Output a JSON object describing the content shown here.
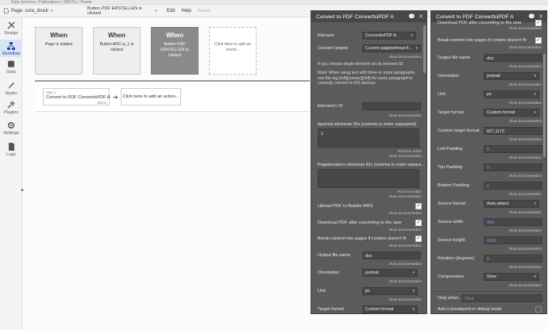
{
  "top_strip": {
    "text": "Data Schema  |  Publications | SMOSs  |  Viewer"
  },
  "toolbar": {
    "page_label": "Page: sora_druck",
    "event_selector": "Button PDF ERSTELLEN is clicked",
    "edit": "Edit",
    "help": "Help",
    "saved": "Saved"
  },
  "sidebar": {
    "items": [
      {
        "label": "Design",
        "icon": "design-icon"
      },
      {
        "label": "Workflow",
        "icon": "workflow-icon"
      },
      {
        "label": "Data",
        "icon": "data-icon"
      },
      {
        "label": "Styles",
        "icon": "styles-icon"
      },
      {
        "label": "Plugins",
        "icon": "plugins-icon"
      },
      {
        "label": "Settings",
        "icon": "settings-icon"
      },
      {
        "label": "Logs",
        "icon": "logs-icon"
      }
    ]
  },
  "events": [
    {
      "when": "When",
      "desc": "Page is loaded"
    },
    {
      "when": "When",
      "desc": "Button ARC-a_1 is clicked"
    },
    {
      "when": "When",
      "desc": "Button PDF ERSTELLEN is clicked"
    },
    {
      "when": "",
      "desc": "Click here to add an event..."
    }
  ],
  "actions": {
    "step_label": "Step 1",
    "step_name": "Convert to PDF ConverttoPDF A",
    "step_delete": "delete",
    "add_action": "Click here to add an action..."
  },
  "panel_left": {
    "title": "Convert to PDF ConverttoPDF A",
    "element_label": "Element",
    "element_value": "ConverttoPDF A",
    "convert_targets_label": "Convert targets",
    "convert_targets_value": "Current page(without fi...",
    "show_doc": "show documentation",
    "note_single": "If you choose single element set its element ID",
    "note_three": "Note! When using text with three or more paragraphs, use the tag [left][/center][/left] for every paragraph to correctly convert in iOS devices",
    "element_id_label": "Element's ID",
    "ignored_label": "Ignored elements IDs (comma or enter separated)",
    "ignored_value": "1",
    "rich_text": "Rich text editor",
    "pagebreakers_label": "Pagebreakers elements IDs (comma or enter separa...",
    "upload_label": "Upload PDF to Bubble AWS",
    "download_label": "Download PDF after converting to the user",
    "break_label": "Break content into pages if content doesn't fit",
    "output_name_label": "Output file name",
    "output_name_value": "doc",
    "orientation_label": "Orientation",
    "orientation_value": "portrait",
    "unit_label": "Unit",
    "unit_value": "px",
    "target_format_label": "Target format",
    "target_format_value": "Custom format"
  },
  "panel_right": {
    "title": "Convert to PDF ConverttoPDF A",
    "download_label": "Download PDF after converting to the user",
    "break_label": "Break content into pages if content doesn't fit",
    "output_name_label": "Output file name",
    "output_name_value": "doc",
    "orientation_label": "Orientation",
    "orientation_value": "portrait",
    "unit_label": "Unit",
    "unit_value": "px",
    "target_format_label": "Target format",
    "target_format_value": "Custom format",
    "custom_target_label": "Custom target format",
    "custom_target_value": "827,1170",
    "left_padding_label": "Left Padding",
    "left_padding_value": "0",
    "top_padding_label": "Top Padding",
    "top_padding_value": "0",
    "bottom_padding_label": "Bottom Padding",
    "bottom_padding_value": "0",
    "source_format_label": "Source format",
    "source_format_value": "Auto-detect",
    "source_width_label": "Source width",
    "source_width_value": "960",
    "source_height_label": "Source height",
    "source_height_value": "1080",
    "rotation_label": "Rotation (degrees)",
    "rotation_value": "0",
    "compression_label": "Compression",
    "compression_value": "Slow",
    "only_when_label": "Only when",
    "only_when_placeholder": "Click",
    "breakpoint_label": "Add a breakpoint in debug mode",
    "show_doc": "show documentation"
  },
  "colors": {
    "panel_bg": "#5b5b5b",
    "panel_header": "#474747",
    "active_nav": "#1a4fa0",
    "selected_event": "#8a8a8a",
    "link_blue": "#6fa3ef"
  }
}
